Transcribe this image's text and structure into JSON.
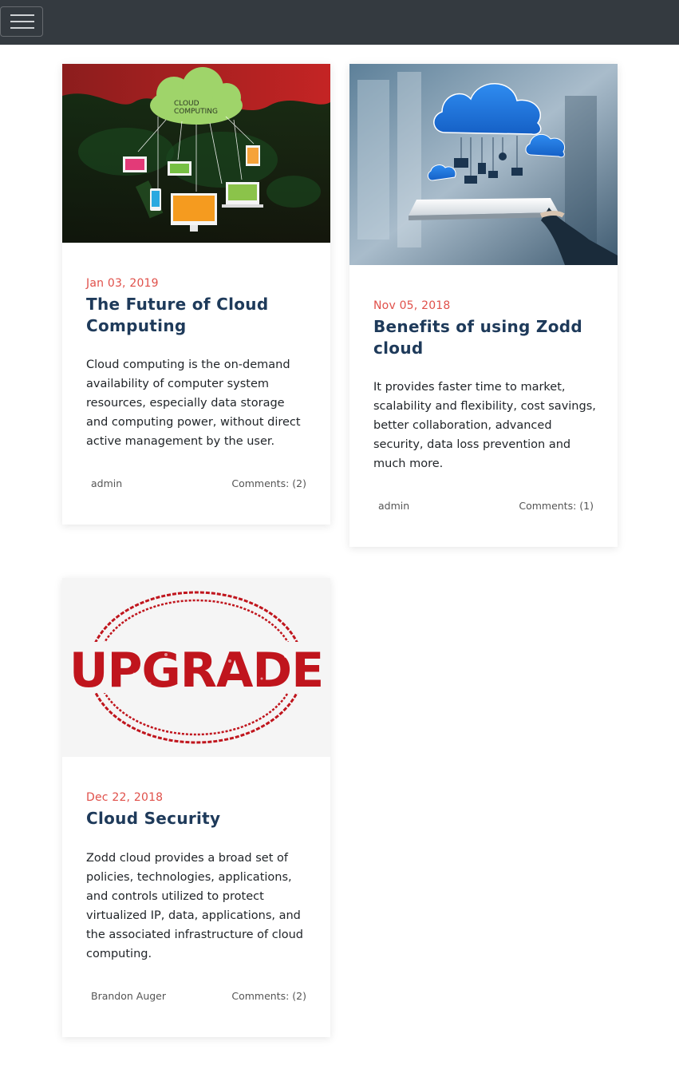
{
  "nav": {
    "toggle_icon": "hamburger-icon",
    "bg": "#343a40"
  },
  "accent": {
    "date": "#e0504a",
    "title": "#1e3a5a"
  },
  "posts": [
    {
      "date": "Jan 03, 2019",
      "title": "The Future of Cloud Computing",
      "excerpt": "Cloud computing is the on-demand availability of computer system resources, especially data storage and computing power, without direct active management by the user.",
      "author": "admin",
      "comments": "Comments: (2)",
      "image_icon": "cloud-computing-world-map-image",
      "image_text": "CLOUD COMPUTING"
    },
    {
      "date": "Nov 05, 2018",
      "title": "Benefits of using Zodd cloud",
      "excerpt": "It provides faster time to market, scalability and flexibility, cost savings, better collaboration, advanced security, data loss prevention and much more.",
      "author": "admin",
      "comments": "Comments: (1)",
      "image_icon": "cloud-on-tablet-image"
    },
    {
      "date": "Dec 22, 2018",
      "title": "Cloud Security",
      "excerpt": "Zodd cloud provides a broad set of policies, technologies, applications, and controls utilized to protect virtualized IP, data, applications, and the associated infrastructure of cloud computing.",
      "author": "Brandon Auger",
      "comments": "Comments: (2)",
      "image_icon": "upgrade-stamp-image",
      "image_text": "UPGRADE"
    }
  ]
}
